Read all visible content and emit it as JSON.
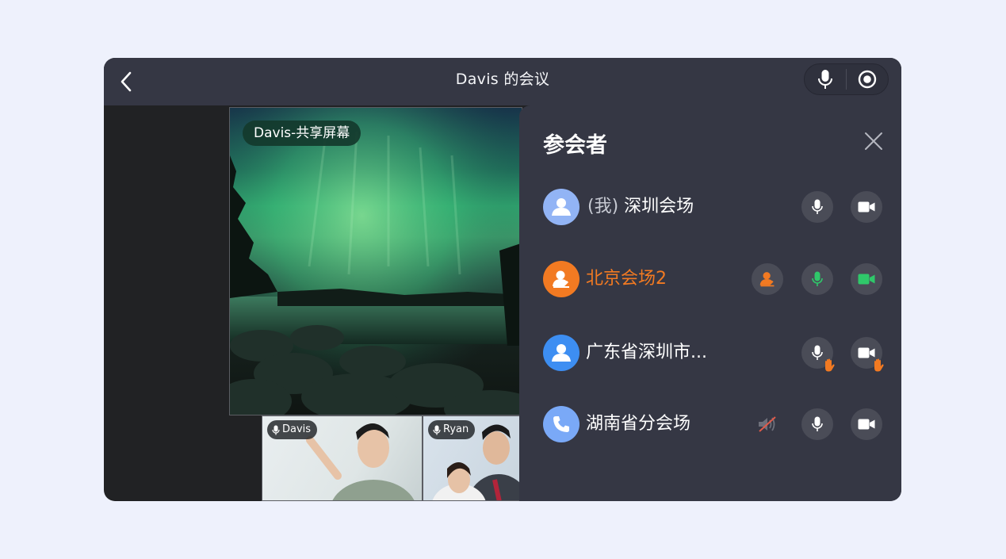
{
  "window": {
    "title": "Davis 的会议"
  },
  "share": {
    "label": "Davis-共享屏幕"
  },
  "thumbnails": [
    {
      "name": "Davis"
    },
    {
      "name": "Ryan"
    }
  ],
  "panel": {
    "title": "参会者",
    "participants": [
      {
        "prefix": "(我)",
        "name": "深圳会场",
        "avatar_color": "#92b4f5",
        "avatar_icon": "user-icon"
      },
      {
        "prefix": "",
        "name": "北京会场2",
        "avatar_color": "#f27a22",
        "avatar_icon": "host-icon",
        "highlight_color": "#f27a22"
      },
      {
        "prefix": "",
        "name": "广东省深圳市...",
        "avatar_color": "#3d8ef2",
        "avatar_icon": "user-icon"
      },
      {
        "prefix": "",
        "name": "湖南省分会场",
        "avatar_color": "#7aa9f7",
        "avatar_icon": "phone-icon"
      }
    ]
  },
  "colors": {
    "background": "#eef1fc",
    "topbar": "#353744",
    "panel": "#353744",
    "active_green": "#2fc86a",
    "host_orange": "#f27a22",
    "mute_red": "#e05a4a"
  }
}
